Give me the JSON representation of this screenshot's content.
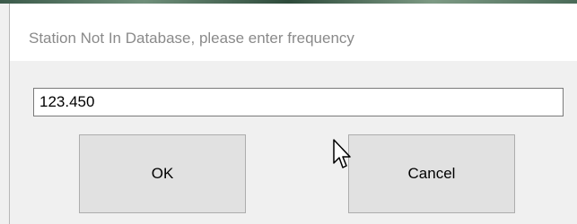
{
  "dialog": {
    "title": "Station Not In Database, please enter frequency",
    "frequency_value": "123.450",
    "ok_label": "OK",
    "cancel_label": "Cancel"
  },
  "icons": {
    "cursor": "mouse-pointer-icon"
  },
  "colors": {
    "dialog_bg": "#f0f0f0",
    "title_bg": "#ffffff",
    "button_bg": "#e1e1e1",
    "title_text": "#8a8a8a"
  }
}
